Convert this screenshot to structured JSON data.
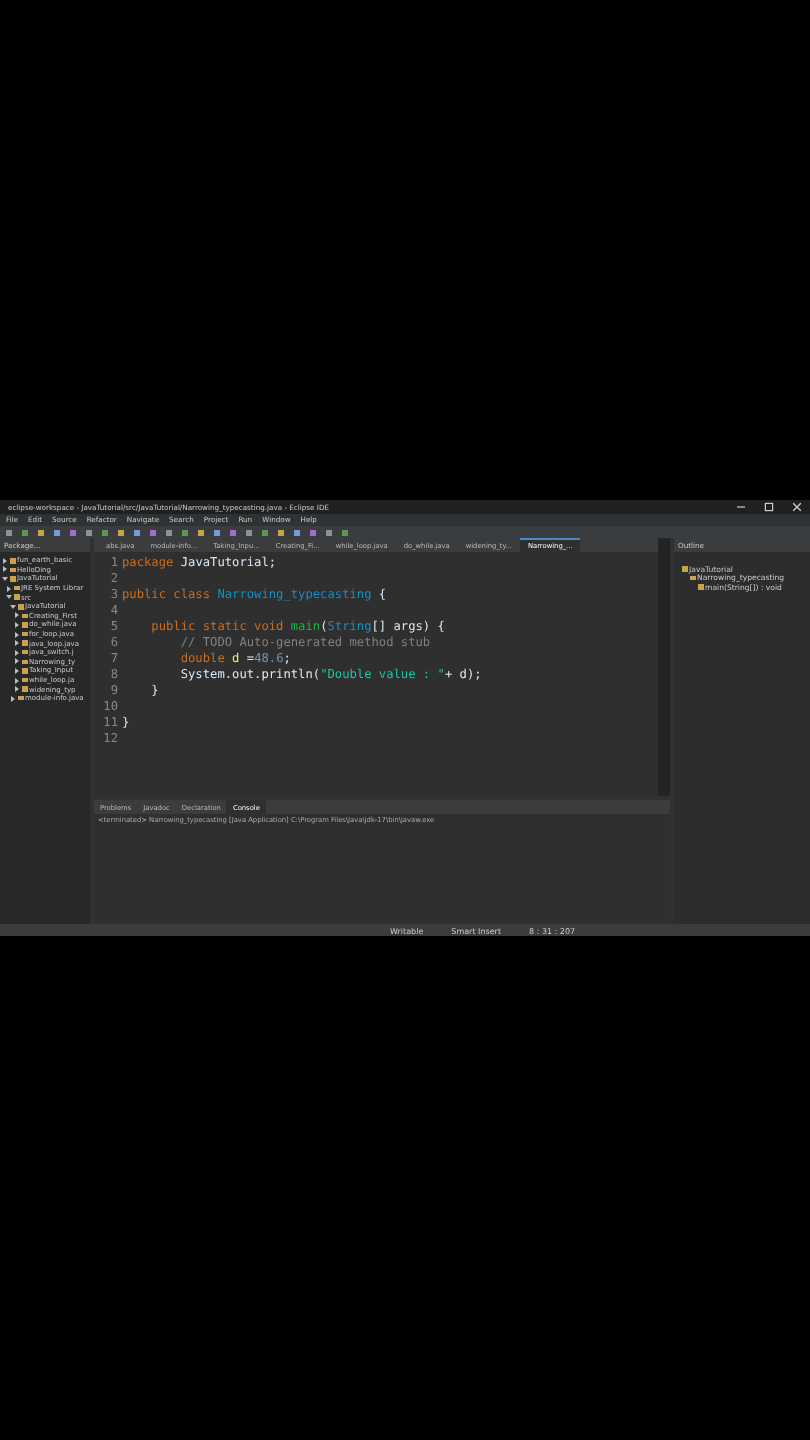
{
  "window": {
    "title": "eclipse-workspace - JavaTutorial/src/JavaTutorial/Narrowing_typecasting.java - Eclipse IDE"
  },
  "menu": [
    "File",
    "Edit",
    "Source",
    "Refactor",
    "Navigate",
    "Search",
    "Project",
    "Run",
    "Window",
    "Help"
  ],
  "package_explorer": {
    "title": "Package...",
    "items": [
      {
        "label": "fun_earth_basic",
        "expanded": false
      },
      {
        "label": "HelloDing",
        "expanded": false
      },
      {
        "label": "JavaTutorial",
        "expanded": true,
        "children": [
          {
            "label": "JRE System Librar",
            "expanded": false
          },
          {
            "label": "src",
            "expanded": true,
            "children": [
              {
                "label": "JavaTutorial",
                "expanded": true,
                "children": [
                  {
                    "label": "Creating_First",
                    "expanded": false
                  },
                  {
                    "label": "do_while.java",
                    "expanded": false
                  },
                  {
                    "label": "for_loop.java",
                    "expanded": false
                  },
                  {
                    "label": "java_loop.java",
                    "expanded": false
                  },
                  {
                    "label": "java_switch.j",
                    "expanded": false
                  },
                  {
                    "label": "Narrowing_ty",
                    "expanded": false
                  },
                  {
                    "label": "Taking_Input",
                    "expanded": false
                  },
                  {
                    "label": "while_loop.ja",
                    "expanded": false
                  },
                  {
                    "label": "widening_typ",
                    "expanded": false
                  }
                ]
              },
              {
                "label": "module-info.java",
                "expanded": false
              }
            ]
          }
        ]
      }
    ]
  },
  "editor_tabs": [
    {
      "label": "abs.java",
      "selected": false
    },
    {
      "label": "module-info...",
      "selected": false
    },
    {
      "label": "Taking_Inpu...",
      "selected": false
    },
    {
      "label": "Creating_Fi...",
      "selected": false
    },
    {
      "label": "while_loop.java",
      "selected": false
    },
    {
      "label": "do_while.java",
      "selected": false
    },
    {
      "label": "widening_ty...",
      "selected": false
    },
    {
      "label": "Narrowing_...",
      "selected": true
    }
  ],
  "code": [
    {
      "number": "1",
      "segments": [
        {
          "text": "package",
          "kind": "keyword"
        },
        {
          "text": " JavaTutorial;",
          "kind": "plain"
        }
      ]
    },
    {
      "number": "2"
    },
    {
      "number": "3",
      "segments": [
        {
          "text": "public class",
          "kind": "keyword"
        },
        {
          "text": " Narrowing_typecasting",
          "kind": "type"
        },
        {
          "text": " {",
          "kind": "plain"
        }
      ]
    },
    {
      "number": "4"
    },
    {
      "number": "5",
      "segments": [
        {
          "text": "    public static void",
          "kind": "keyword"
        },
        {
          "text": " main",
          "kind": "method"
        },
        {
          "text": "(",
          "kind": "plain"
        },
        {
          "text": "String",
          "kind": "type"
        },
        {
          "text": "[] args) {",
          "kind": "plain"
        }
      ]
    },
    {
      "number": "6",
      "segments": [
        {
          "text": "        // TODO Auto-generated method stub",
          "kind": "comment"
        }
      ]
    },
    {
      "number": "7",
      "segments": [
        {
          "text": "        double",
          "kind": "keyword"
        },
        {
          "text": " d",
          "kind": "variable"
        },
        {
          "text": " =",
          "kind": "plain"
        },
        {
          "text": "48.6",
          "kind": "number"
        },
        {
          "text": ";",
          "kind": "plain"
        }
      ]
    },
    {
      "number": "8",
      "segments": [
        {
          "text": "        System.out.println(",
          "kind": "plain"
        },
        {
          "text": "\"Double value : \"",
          "kind": "string"
        },
        {
          "text": "+ d);",
          "kind": "plain"
        }
      ]
    },
    {
      "number": "9",
      "segments": [
        {
          "text": "    }",
          "kind": "plain"
        }
      ]
    },
    {
      "number": "10"
    },
    {
      "number": "11",
      "segments": [
        {
          "text": "}",
          "kind": "plain"
        }
      ]
    },
    {
      "number": "12"
    }
  ],
  "outline": {
    "title": "Outline",
    "items": [
      {
        "label": "JavaTutorial"
      },
      {
        "label": "Narrowing_typecasting"
      },
      {
        "label": "main(String[]) : void"
      }
    ]
  },
  "bottom_tabs": [
    {
      "label": "Problems",
      "selected": false
    },
    {
      "label": "Javadoc",
      "selected": false
    },
    {
      "label": "Declaration",
      "selected": false
    },
    {
      "label": "Console",
      "selected": true
    }
  ],
  "console": {
    "header": "<terminated> Narrowing_typecasting [Java Application] C:\\Program Files\\Java\\jdk-17\\bin\\javaw.exe"
  },
  "status_bar": [
    "Writable",
    "Smart Insert",
    "8 : 31 : 207"
  ]
}
